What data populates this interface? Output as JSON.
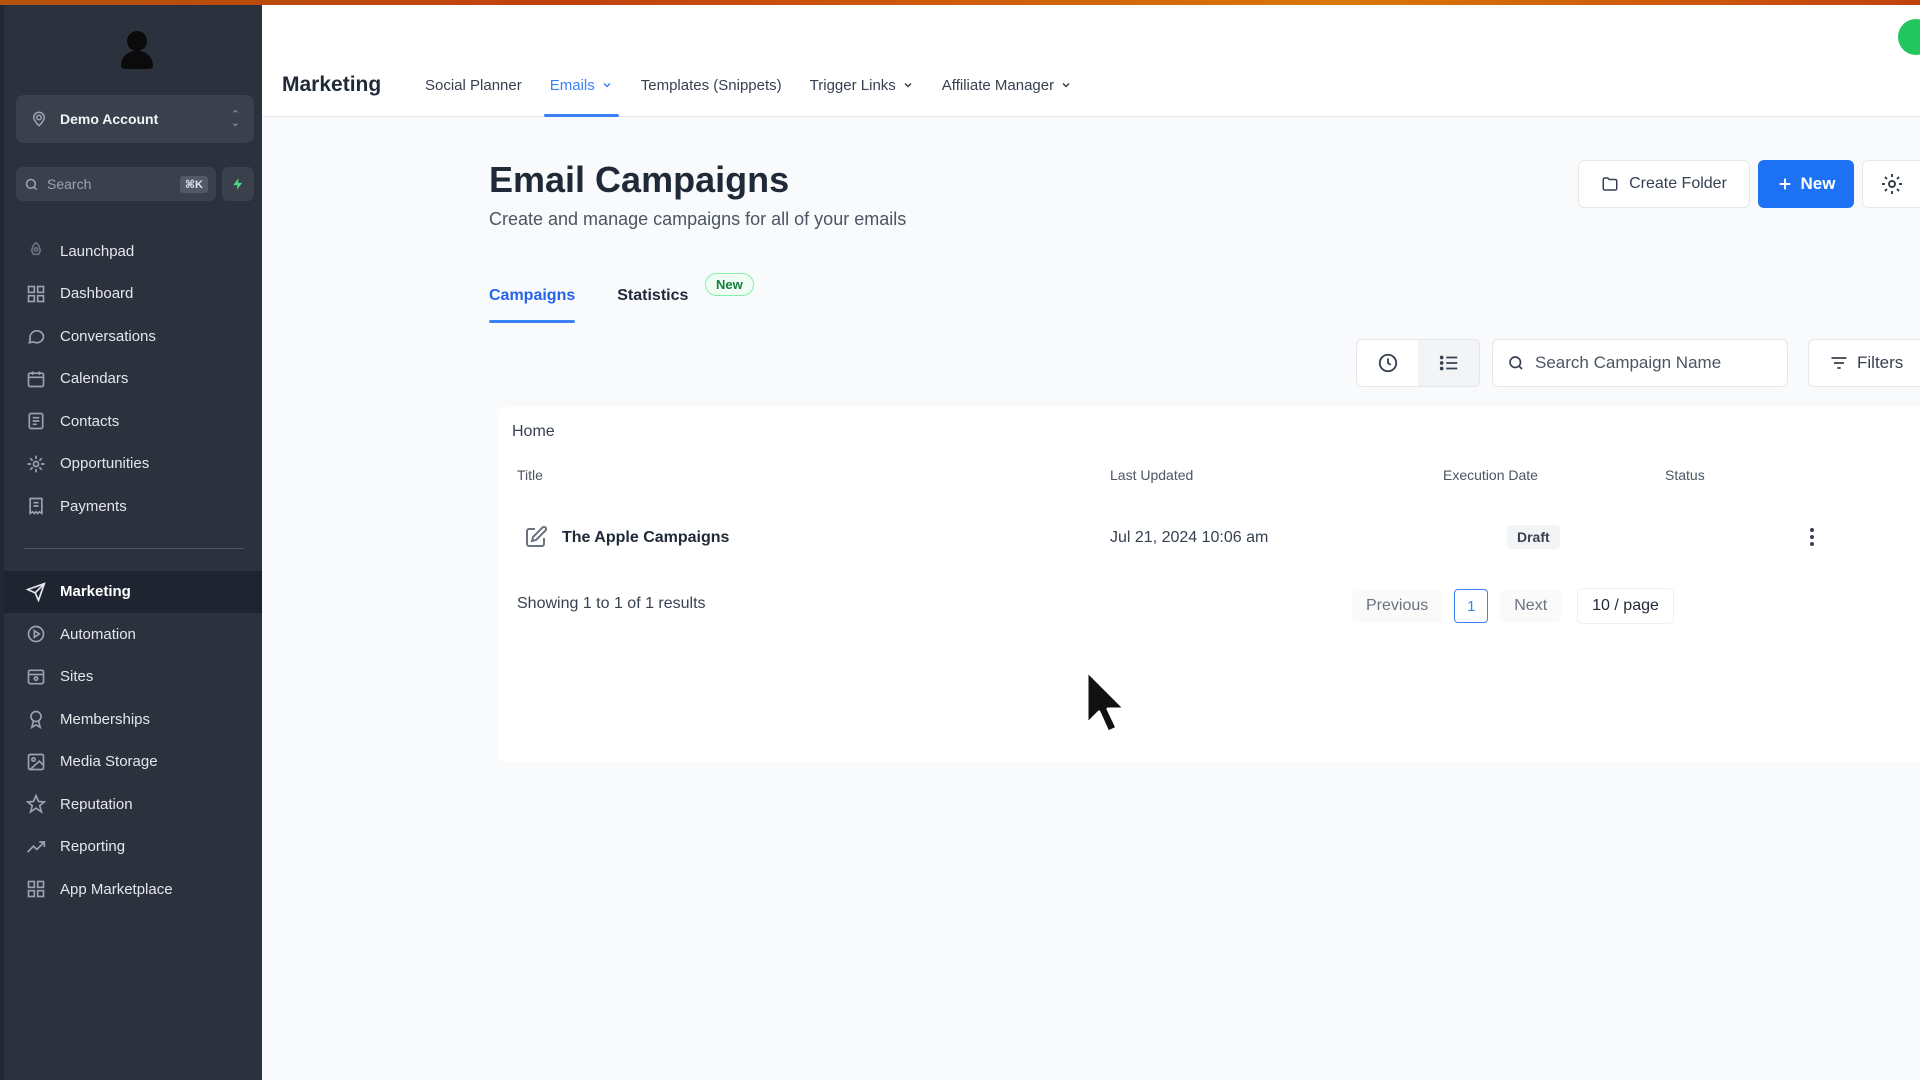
{
  "colors": {
    "sidebar_bg": "#2b313d",
    "accent": "#1d72f3",
    "tab_active": "#3b82f6",
    "badge_green": "#15803d"
  },
  "sidebar": {
    "account_name": "Demo Account",
    "search_placeholder": "Search",
    "search_shortcut": "⌘K",
    "items_top": [
      {
        "label": "Launchpad",
        "icon": "rocket-icon"
      },
      {
        "label": "Dashboard",
        "icon": "grid-icon"
      },
      {
        "label": "Conversations",
        "icon": "chat-icon"
      },
      {
        "label": "Calendars",
        "icon": "calendar-icon"
      },
      {
        "label": "Contacts",
        "icon": "contacts-icon"
      },
      {
        "label": "Opportunities",
        "icon": "opportunities-icon"
      },
      {
        "label": "Payments",
        "icon": "receipt-icon"
      }
    ],
    "items_bottom": [
      {
        "label": "Marketing",
        "icon": "send-icon",
        "active": true
      },
      {
        "label": "Automation",
        "icon": "automation-icon"
      },
      {
        "label": "Sites",
        "icon": "sites-icon"
      },
      {
        "label": "Memberships",
        "icon": "membership-icon"
      },
      {
        "label": "Media Storage",
        "icon": "image-icon"
      },
      {
        "label": "Reputation",
        "icon": "star-icon"
      },
      {
        "label": "Reporting",
        "icon": "trend-icon"
      },
      {
        "label": "App Marketplace",
        "icon": "apps-icon"
      }
    ]
  },
  "topbar": {
    "brand": "Marketing",
    "nav": [
      {
        "label": "Social Planner",
        "dropdown": false
      },
      {
        "label": "Emails",
        "dropdown": true,
        "active": true
      },
      {
        "label": "Templates (Snippets)",
        "dropdown": false
      },
      {
        "label": "Trigger Links",
        "dropdown": true
      },
      {
        "label": "Affiliate Manager",
        "dropdown": true
      }
    ]
  },
  "page": {
    "title": "Email Campaigns",
    "subtitle": "Create and manage campaigns for all of your emails",
    "create_folder_label": "Create Folder",
    "new_label": "New",
    "tabs": [
      {
        "label": "Campaigns",
        "active": true
      },
      {
        "label": "Statistics"
      }
    ],
    "statistics_badge": "New",
    "search_placeholder": "Search Campaign Name",
    "filters_label": "Filters"
  },
  "table": {
    "breadcrumb": "Home",
    "columns": [
      "Title",
      "Last Updated",
      "Execution Date",
      "Status"
    ],
    "rows": [
      {
        "title": "The Apple Campaigns",
        "last_updated": "Jul 21, 2024 10:06 am",
        "execution_date": "",
        "status": "Draft"
      }
    ],
    "showing": "Showing 1 to 1 of 1 results",
    "pagination": {
      "previous": "Previous",
      "current": "1",
      "next": "Next",
      "page_size": "10 / page"
    }
  }
}
